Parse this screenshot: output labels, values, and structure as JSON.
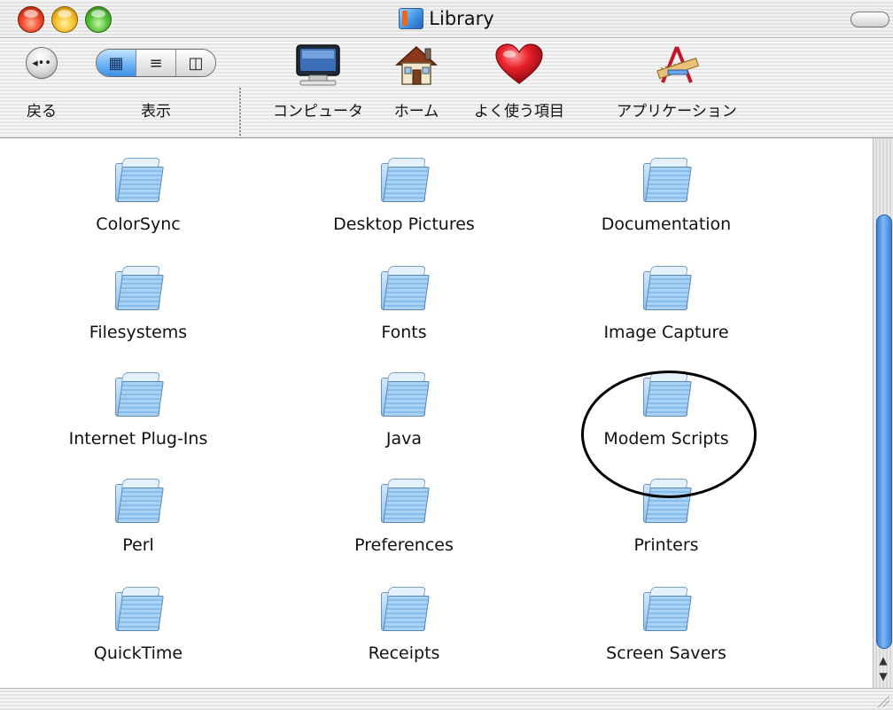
{
  "window": {
    "title": "Library"
  },
  "toolbar": {
    "back_label": "戻る",
    "view_label": "表示",
    "places": [
      {
        "label": "コンピュータ",
        "icon": "computer-icon"
      },
      {
        "label": "ホーム",
        "icon": "home-icon"
      },
      {
        "label": "よく使う項目",
        "icon": "favorites-heart-icon"
      },
      {
        "label": "アプリケーション",
        "icon": "applications-icon"
      }
    ]
  },
  "folders": [
    {
      "name": "ColorSync"
    },
    {
      "name": "Desktop Pictures"
    },
    {
      "name": "Documentation"
    },
    {
      "name": "Filesystems"
    },
    {
      "name": "Fonts"
    },
    {
      "name": "Image Capture"
    },
    {
      "name": "Internet Plug-Ins"
    },
    {
      "name": "Java"
    },
    {
      "name": "Modem Scripts"
    },
    {
      "name": "Perl"
    },
    {
      "name": "Preferences"
    },
    {
      "name": "Printers"
    },
    {
      "name": "QuickTime"
    },
    {
      "name": "Receipts"
    },
    {
      "name": "Screen Savers"
    }
  ],
  "colors": {
    "accent": "#3d8fe4",
    "close": "#f04a2a",
    "minimize": "#f6c02a",
    "zoom": "#55c13a"
  }
}
